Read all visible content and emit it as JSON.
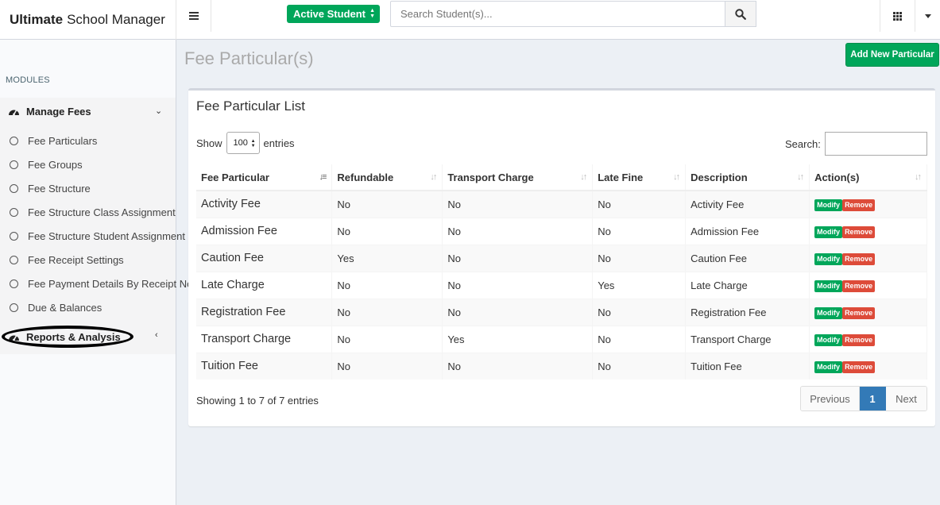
{
  "header": {
    "brand_bold": "Ultimate",
    "brand_rest": "School Manager",
    "student_filter": "Active Student",
    "search_placeholder": "Search Student(s)..."
  },
  "sidebar": {
    "modules_label": "MODULES",
    "manage_fees": "Manage Fees",
    "items": [
      "Fee Particulars",
      "Fee Groups",
      "Fee Structure",
      "Fee Structure Class Assignment",
      "Fee Structure Student Assignment",
      "Fee Receipt Settings",
      "Fee Payment Details By Receipt No.",
      "Due & Balances"
    ],
    "reports": "Reports & Analysis"
  },
  "page": {
    "title": "Fee Particular(s)",
    "add_button": "Add New Particular"
  },
  "box": {
    "title": "Fee Particular List",
    "show": "Show",
    "entries": "entries",
    "length": "100",
    "search_label": "Search:",
    "info": "Showing 1 to 7 of 7 entries",
    "prev": "Previous",
    "page": "1",
    "next": "Next",
    "modify": "Modify",
    "remove": "Remove"
  },
  "table": {
    "headers": [
      "Fee Particular",
      "Refundable",
      "Transport Charge",
      "Late Fine",
      "Description",
      "Action(s)"
    ],
    "rows": [
      [
        "Activity Fee",
        "No",
        "No",
        "No",
        "Activity Fee"
      ],
      [
        "Admission Fee",
        "No",
        "No",
        "No",
        "Admission Fee"
      ],
      [
        "Caution Fee",
        "Yes",
        "No",
        "No",
        "Caution Fee"
      ],
      [
        "Late Charge",
        "No",
        "No",
        "Yes",
        "Late Charge"
      ],
      [
        "Registration Fee",
        "No",
        "No",
        "No",
        "Registration Fee"
      ],
      [
        "Transport Charge",
        "No",
        "Yes",
        "No",
        "Transport Charge"
      ],
      [
        "Tuition Fee",
        "No",
        "No",
        "No",
        "Tuition Fee"
      ]
    ]
  }
}
